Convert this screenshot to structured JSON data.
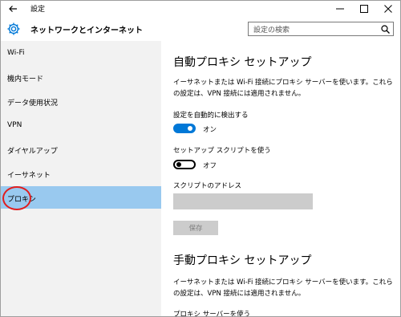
{
  "window": {
    "title": "設定"
  },
  "header": {
    "title": "ネットワークとインターネット",
    "search_placeholder": "設定の検索"
  },
  "sidebar": {
    "items": [
      {
        "label": "Wi-Fi"
      },
      {
        "label": "機内モード"
      },
      {
        "label": "データ使用状況"
      },
      {
        "label": "VPN"
      },
      {
        "label": "ダイヤルアップ"
      },
      {
        "label": "イーサネット"
      },
      {
        "label": "プロキシ",
        "selected": true
      }
    ]
  },
  "auto_proxy": {
    "heading": "自動プロキシ セットアップ",
    "description": "イーサネットまたは Wi-Fi 接続にプロキシ サーバーを使います。これらの設定は、VPN 接続には適用されません。",
    "detect_label": "設定を自動的に検出する",
    "detect_state": "オン",
    "script_label": "セットアップ スクリプトを使う",
    "script_state": "オフ",
    "address_label": "スクリプトのアドレス",
    "address_value": "",
    "save_label": "保存"
  },
  "manual_proxy": {
    "heading": "手動プロキシ セットアップ",
    "description": "イーサネットまたは Wi-Fi 接続にプロキシ サーバーを使います。これらの設定は、VPN 接続には適用されません。",
    "use_server_label": "プロキシ サーバーを使う"
  },
  "colors": {
    "accent": "#0078d7",
    "selected_nav": "#99c9ef",
    "sidebar_bg": "#f2f2f2",
    "annotation_ring": "#e21d1d"
  }
}
